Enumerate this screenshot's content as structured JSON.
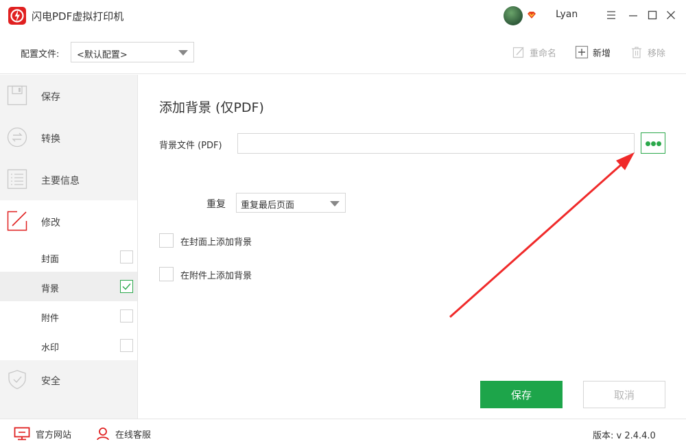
{
  "app": {
    "title": "闪电PDF虚拟打印机",
    "user_name": "Lyan"
  },
  "config": {
    "label": "配置文件:",
    "selected": "<默认配置>"
  },
  "toolbar": {
    "rename_label": "重命名",
    "new_label": "新增",
    "remove_label": "移除"
  },
  "sidebar": {
    "sections": [
      "保存",
      "转换",
      "主要信息",
      "修改",
      "安全"
    ],
    "sub_items": [
      {
        "label": "封面",
        "checked": false
      },
      {
        "label": "背景",
        "checked": true
      },
      {
        "label": "附件",
        "checked": false
      },
      {
        "label": "水印",
        "checked": false
      }
    ]
  },
  "main": {
    "title": "添加背景 (仅PDF)",
    "bg_file_label": "背景文件 (PDF)",
    "bg_file_value": "",
    "repeat_label": "重复",
    "repeat_value": "重复最后页面",
    "options": [
      {
        "label": "在封面上添加背景",
        "checked": false
      },
      {
        "label": "在附件上添加背景",
        "checked": false
      }
    ],
    "save_label": "保存",
    "cancel_label": "取消"
  },
  "footer": {
    "site_label": "官方网站",
    "service_label": "在线客服",
    "version": "版本: v 2.4.4.0"
  },
  "colors": {
    "accent_green": "#1da54a",
    "brand_red": "#e02020",
    "annotation_red": "#f02a2a"
  },
  "icons": [
    "app-logo-icon",
    "vip-badge-icon",
    "menu-icon",
    "minimize-icon",
    "maximize-icon",
    "close-icon",
    "rename-icon",
    "add-icon",
    "trash-icon",
    "save-icon",
    "convert-icon",
    "info-icon",
    "edit-icon",
    "security-icon",
    "checkmark-icon",
    "more-dots-icon",
    "monitor-icon",
    "person-icon"
  ]
}
